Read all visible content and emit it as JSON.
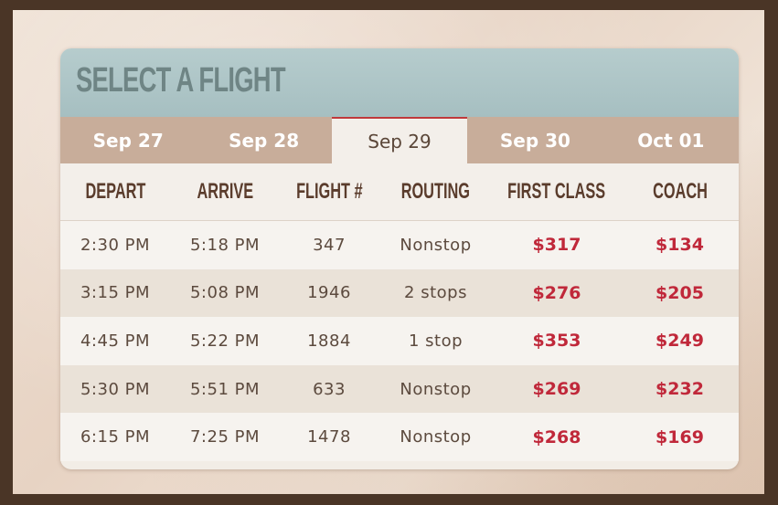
{
  "title": "SELECT A FLIGHT",
  "tabs": [
    {
      "label": "Sep 27"
    },
    {
      "label": "Sep 28"
    },
    {
      "label": "Sep 29"
    },
    {
      "label": "Sep 30"
    },
    {
      "label": "Oct 01"
    }
  ],
  "active_tab": "Sep 29",
  "columns": [
    "DEPART",
    "ARRIVE",
    "FLIGHT #",
    "ROUTING",
    "FIRST CLASS",
    "COACH"
  ],
  "flights": [
    {
      "depart": "2:30 PM",
      "arrive": "5:18 PM",
      "flight": "347",
      "routing": "Nonstop",
      "first": "$317",
      "coach": "$134"
    },
    {
      "depart": "3:15 PM",
      "arrive": "5:08 PM",
      "flight": "1946",
      "routing": "2 stops",
      "first": "$276",
      "coach": "$205"
    },
    {
      "depart": "4:45 PM",
      "arrive": "5:22 PM",
      "flight": "1884",
      "routing": "1 stop",
      "first": "$353",
      "coach": "$249"
    },
    {
      "depart": "5:30 PM",
      "arrive": "5:51 PM",
      "flight": "633",
      "routing": "Nonstop",
      "first": "$269",
      "coach": "$232"
    },
    {
      "depart": "6:15 PM",
      "arrive": "7:25 PM",
      "flight": "1478",
      "routing": "Nonstop",
      "first": "$268",
      "coach": "$169"
    }
  ],
  "colors": {
    "accent": "#c0393b",
    "price": "#c0283a",
    "header": "#b6cccd",
    "tab_bar": "#c8ad9a"
  }
}
